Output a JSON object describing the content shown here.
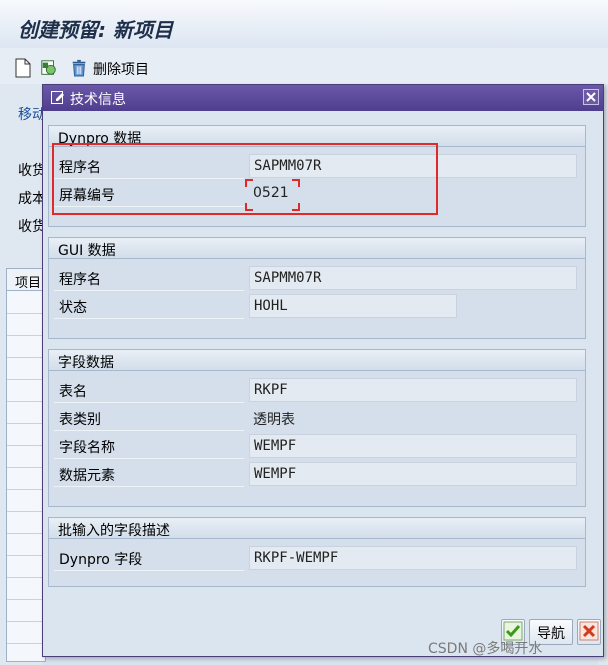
{
  "app": {
    "title": "创建预留: 新项目",
    "toolbar": {
      "delete_item_label": "删除项目"
    },
    "bg_labels": {
      "move": "移动",
      "recv1": "收货",
      "cost": "成本",
      "recv2": "收货",
      "items_tab": "项目"
    }
  },
  "dialog": {
    "title": "技术信息",
    "groups": {
      "dynpro": {
        "title": "Dynpro 数据",
        "program_label": "程序名",
        "program_value": "SAPMM07R",
        "screen_label": "屏幕编号",
        "screen_value": "0521"
      },
      "gui": {
        "title": "GUI 数据",
        "program_label": "程序名",
        "program_value": "SAPMM07R",
        "status_label": "状态",
        "status_value": "HOHL"
      },
      "field": {
        "title": "字段数据",
        "table_label": "表名",
        "table_value": "RKPF",
        "table_type_label": "表类别",
        "table_type_value": "透明表",
        "field_name_label": "字段名称",
        "field_name_value": "WEMPF",
        "data_element_label": "数据元素",
        "data_element_value": "WEMPF"
      },
      "batch": {
        "title": "批输入的字段描述",
        "dynpro_field_label": "Dynpro 字段",
        "dynpro_field_value": "RKPF-WEMPF"
      }
    },
    "buttons": {
      "navigate_label": "导航"
    }
  },
  "watermark": "CSDN @多喝开水",
  "colors": {
    "title_bar": "#5a479a",
    "highlight": "#e02a2a",
    "ok_green": "#3a9a1a",
    "cancel_red": "#d23a1e"
  }
}
